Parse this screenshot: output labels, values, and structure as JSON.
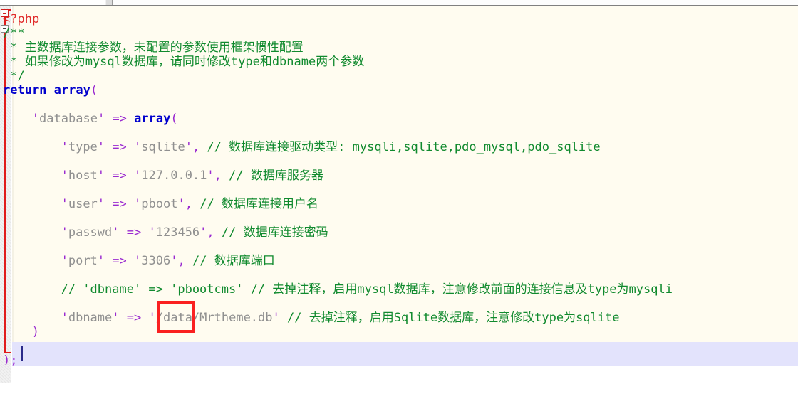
{
  "window": {
    "app": "code-editor",
    "file_language": "php"
  },
  "colors": {
    "editor_background": "#fffcf0",
    "gutter_background": "#f2f2f2",
    "current_line_highlight": "#e3e3fc",
    "comment": "#108a2e",
    "keyword": "#0000cd",
    "punctuation": "#9a2ad0",
    "string_text": "#909090",
    "php_tag": "#e02a2a",
    "fold_bracket": "#e01b1b",
    "annotation_box": "#fa2020"
  },
  "annotation": {
    "name": "red-highlight-rectangle",
    "targets_text": "/data",
    "shape": "rectangle"
  },
  "code": {
    "lines": [
      {
        "id": "line-php-open",
        "indent": 0,
        "tokens": [
          {
            "cls": "t-php",
            "text": "<?php"
          }
        ]
      },
      {
        "id": "line-doc-open",
        "indent": 0,
        "tokens": [
          {
            "cls": "t-cmt",
            "text": "/**"
          }
        ]
      },
      {
        "id": "line-doc-1",
        "indent": 0,
        "tokens": [
          {
            "cls": "t-cmt",
            "text": " * 主数据库连接参数，未配置的参数使用框架惯性配置"
          }
        ]
      },
      {
        "id": "line-doc-2",
        "indent": 0,
        "tokens": [
          {
            "cls": "t-cmt",
            "text": " * 如果修改为mysql数据库，请同时修改type和dbname两个参数"
          }
        ]
      },
      {
        "id": "line-doc-close",
        "indent": 0,
        "tokens": [
          {
            "cls": "t-cmt",
            "text": " */"
          }
        ]
      },
      {
        "id": "line-return-array",
        "indent": 0,
        "tokens": [
          {
            "cls": "t-kw",
            "text": "return array"
          },
          {
            "cls": "t-punc",
            "text": "("
          }
        ]
      },
      {
        "id": "line-blank-1",
        "indent": 0,
        "tokens": []
      },
      {
        "id": "line-database",
        "indent": 4,
        "tokens": [
          {
            "cls": "t-str",
            "text": "'"
          },
          {
            "cls": "t-strtxt",
            "text": "database"
          },
          {
            "cls": "t-str",
            "text": "'"
          },
          {
            "cls": "t-plain",
            "text": " "
          },
          {
            "cls": "t-punc",
            "text": "=>"
          },
          {
            "cls": "t-plain",
            "text": " "
          },
          {
            "cls": "t-kw",
            "text": "array"
          },
          {
            "cls": "t-punc",
            "text": "("
          }
        ]
      },
      {
        "id": "line-blank-2",
        "indent": 0,
        "tokens": []
      },
      {
        "id": "line-type",
        "indent": 8,
        "tokens": [
          {
            "cls": "t-str",
            "text": "'"
          },
          {
            "cls": "t-strtxt",
            "text": "type"
          },
          {
            "cls": "t-str",
            "text": "'"
          },
          {
            "cls": "t-plain",
            "text": " "
          },
          {
            "cls": "t-punc",
            "text": "=>"
          },
          {
            "cls": "t-plain",
            "text": " "
          },
          {
            "cls": "t-str",
            "text": "'"
          },
          {
            "cls": "t-strtxt",
            "text": "sqlite"
          },
          {
            "cls": "t-str",
            "text": "'"
          },
          {
            "cls": "t-punc",
            "text": ","
          },
          {
            "cls": "t-plain",
            "text": " "
          },
          {
            "cls": "t-cmt",
            "text": "// 数据库连接驱动类型: mysqli,sqlite,pdo_mysql,pdo_sqlite"
          }
        ]
      },
      {
        "id": "line-blank-3",
        "indent": 0,
        "tokens": []
      },
      {
        "id": "line-host",
        "indent": 8,
        "tokens": [
          {
            "cls": "t-str",
            "text": "'"
          },
          {
            "cls": "t-strtxt",
            "text": "host"
          },
          {
            "cls": "t-str",
            "text": "'"
          },
          {
            "cls": "t-plain",
            "text": " "
          },
          {
            "cls": "t-punc",
            "text": "=>"
          },
          {
            "cls": "t-plain",
            "text": " "
          },
          {
            "cls": "t-str",
            "text": "'"
          },
          {
            "cls": "t-strtxt",
            "text": "127.0.0.1"
          },
          {
            "cls": "t-str",
            "text": "'"
          },
          {
            "cls": "t-punc",
            "text": ","
          },
          {
            "cls": "t-plain",
            "text": " "
          },
          {
            "cls": "t-cmt",
            "text": "// 数据库服务器"
          }
        ]
      },
      {
        "id": "line-blank-4",
        "indent": 0,
        "tokens": []
      },
      {
        "id": "line-user",
        "indent": 8,
        "tokens": [
          {
            "cls": "t-str",
            "text": "'"
          },
          {
            "cls": "t-strtxt",
            "text": "user"
          },
          {
            "cls": "t-str",
            "text": "'"
          },
          {
            "cls": "t-plain",
            "text": " "
          },
          {
            "cls": "t-punc",
            "text": "=>"
          },
          {
            "cls": "t-plain",
            "text": " "
          },
          {
            "cls": "t-str",
            "text": "'"
          },
          {
            "cls": "t-strtxt",
            "text": "pboot"
          },
          {
            "cls": "t-str",
            "text": "'"
          },
          {
            "cls": "t-punc",
            "text": ","
          },
          {
            "cls": "t-plain",
            "text": " "
          },
          {
            "cls": "t-cmt",
            "text": "// 数据库连接用户名"
          }
        ]
      },
      {
        "id": "line-blank-5",
        "indent": 0,
        "tokens": []
      },
      {
        "id": "line-passwd",
        "indent": 8,
        "tokens": [
          {
            "cls": "t-str",
            "text": "'"
          },
          {
            "cls": "t-strtxt",
            "text": "passwd"
          },
          {
            "cls": "t-str",
            "text": "'"
          },
          {
            "cls": "t-plain",
            "text": " "
          },
          {
            "cls": "t-punc",
            "text": "=>"
          },
          {
            "cls": "t-plain",
            "text": " "
          },
          {
            "cls": "t-str",
            "text": "'"
          },
          {
            "cls": "t-strtxt",
            "text": "123456"
          },
          {
            "cls": "t-str",
            "text": "'"
          },
          {
            "cls": "t-punc",
            "text": ","
          },
          {
            "cls": "t-plain",
            "text": " "
          },
          {
            "cls": "t-cmt",
            "text": "// 数据库连接密码"
          }
        ]
      },
      {
        "id": "line-blank-6",
        "indent": 0,
        "tokens": []
      },
      {
        "id": "line-port",
        "indent": 8,
        "tokens": [
          {
            "cls": "t-str",
            "text": "'"
          },
          {
            "cls": "t-strtxt",
            "text": "port"
          },
          {
            "cls": "t-str",
            "text": "'"
          },
          {
            "cls": "t-plain",
            "text": " "
          },
          {
            "cls": "t-punc",
            "text": "=>"
          },
          {
            "cls": "t-plain",
            "text": " "
          },
          {
            "cls": "t-str",
            "text": "'"
          },
          {
            "cls": "t-strtxt",
            "text": "3306"
          },
          {
            "cls": "t-str",
            "text": "'"
          },
          {
            "cls": "t-punc",
            "text": ","
          },
          {
            "cls": "t-plain",
            "text": " "
          },
          {
            "cls": "t-cmt",
            "text": "// 数据库端口"
          }
        ]
      },
      {
        "id": "line-blank-7",
        "indent": 0,
        "tokens": []
      },
      {
        "id": "line-dbname-commented",
        "indent": 8,
        "tokens": [
          {
            "cls": "t-cmt",
            "text": "// 'dbname' => 'pbootcms' // 去掉注释，启用mysql数据库，注意修改前面的连接信息及type为mysqli"
          }
        ]
      },
      {
        "id": "line-blank-8",
        "indent": 0,
        "tokens": []
      },
      {
        "id": "line-dbname-active",
        "indent": 8,
        "tokens": [
          {
            "cls": "t-str",
            "text": "'"
          },
          {
            "cls": "t-strtxt",
            "text": "dbname"
          },
          {
            "cls": "t-str",
            "text": "'"
          },
          {
            "cls": "t-plain",
            "text": " "
          },
          {
            "cls": "t-punc",
            "text": "=>"
          },
          {
            "cls": "t-plain",
            "text": " "
          },
          {
            "cls": "t-str",
            "text": "'"
          },
          {
            "cls": "t-strtxt",
            "text": "/data/Mrtheme.db"
          },
          {
            "cls": "t-str",
            "text": "'"
          },
          {
            "cls": "t-plain",
            "text": " "
          },
          {
            "cls": "t-cmt",
            "text": "// 去掉注释，启用Sqlite数据库，注意修改type为sqlite"
          }
        ]
      },
      {
        "id": "line-close-inner",
        "indent": 4,
        "tokens": [
          {
            "cls": "t-punc",
            "text": ")"
          }
        ]
      },
      {
        "id": "line-blank-9",
        "indent": 0,
        "tokens": []
      },
      {
        "id": "line-close-outer",
        "indent": 0,
        "current": true,
        "tokens": [
          {
            "cls": "t-punc",
            "text": ");"
          }
        ]
      }
    ]
  }
}
